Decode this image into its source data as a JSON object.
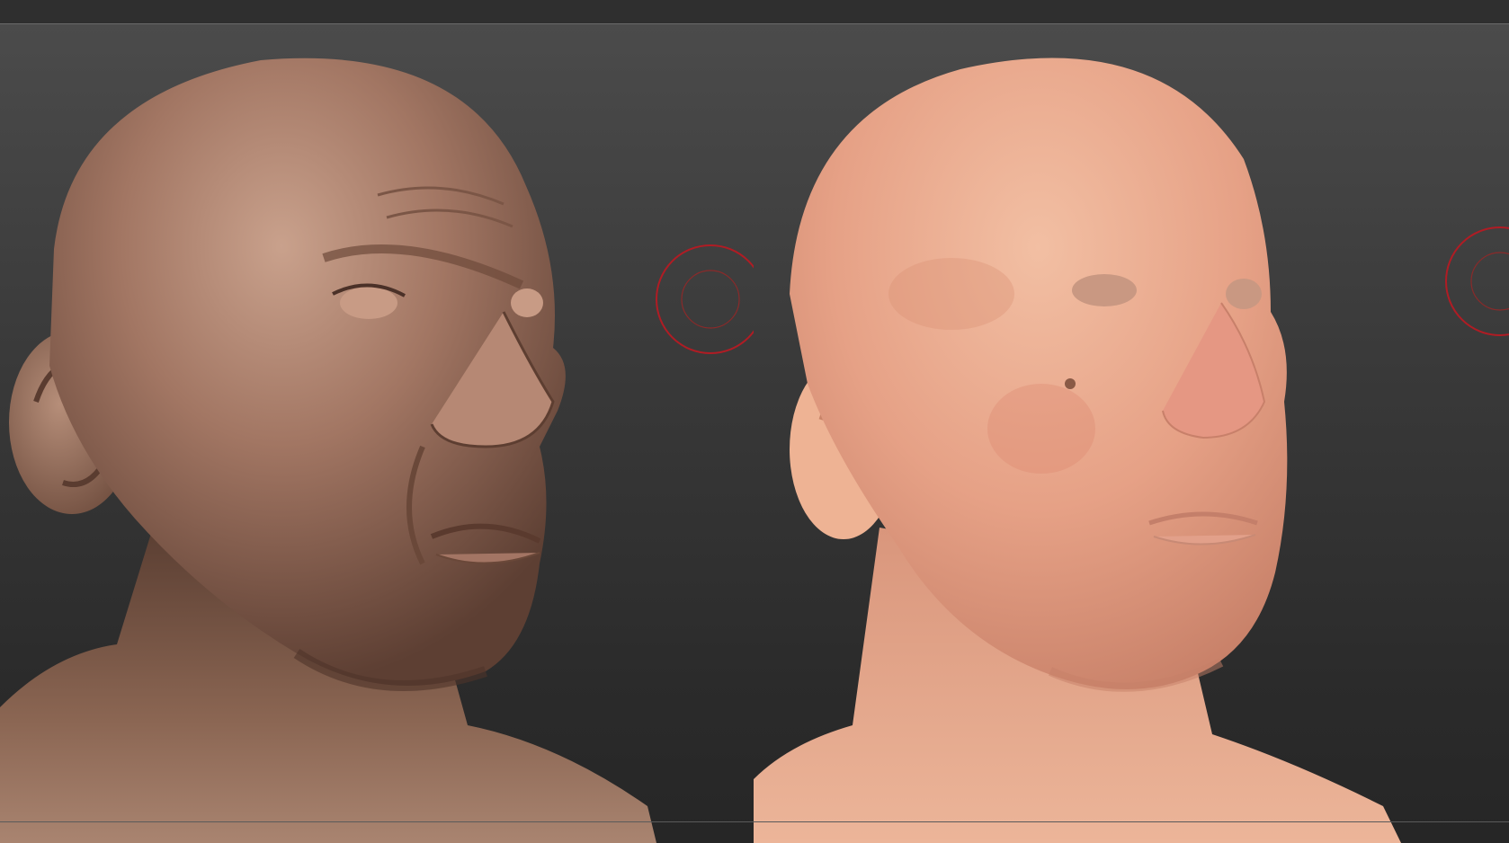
{
  "app": {
    "topbar": {},
    "viewports": [
      {
        "name": "sculpt-view",
        "material": "clay-shaded",
        "colors": {
          "skin": "#a57a66",
          "skin_dark": "#4f362b",
          "skin_light": "#c7a08b"
        }
      },
      {
        "name": "texture-view",
        "material": "polypaint-skin",
        "colors": {
          "skin": "#e8a48a",
          "skin_dark": "#c4866e",
          "skin_light": "#f3c0a4"
        }
      }
    ],
    "gizmo": {
      "color": "#b01c24",
      "icon": "rotate-gizmo-icon"
    },
    "background": {
      "top": "#4b4b4b",
      "bottom": "#262626"
    }
  }
}
